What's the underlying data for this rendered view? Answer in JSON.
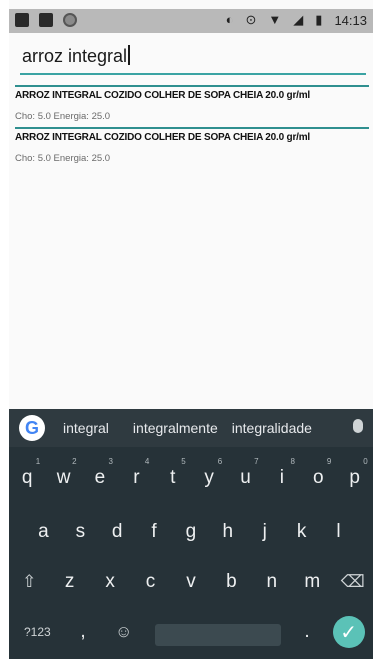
{
  "status_bar": {
    "time": "14:13"
  },
  "search": {
    "value": "arroz integral"
  },
  "results": [
    {
      "title": "ARROZ INTEGRAL COZIDO  COLHER DE SOPA CHEIA 20.0 gr/ml",
      "sub": "Cho: 5.0 Energia: 25.0"
    },
    {
      "title": "ARROZ INTEGRAL COZIDO  COLHER DE SOPA CHEIA 20.0 gr/ml",
      "sub": "Cho: 5.0 Energia: 25.0"
    }
  ],
  "keyboard": {
    "suggestions": [
      "integral",
      "integralmente",
      "integralidade"
    ],
    "row1": [
      {
        "k": "q",
        "n": "1"
      },
      {
        "k": "w",
        "n": "2"
      },
      {
        "k": "e",
        "n": "3"
      },
      {
        "k": "r",
        "n": "4"
      },
      {
        "k": "t",
        "n": "5"
      },
      {
        "k": "y",
        "n": "6"
      },
      {
        "k": "u",
        "n": "7"
      },
      {
        "k": "i",
        "n": "8"
      },
      {
        "k": "o",
        "n": "9"
      },
      {
        "k": "p",
        "n": "0"
      }
    ],
    "row2": [
      "a",
      "s",
      "d",
      "f",
      "g",
      "h",
      "j",
      "k",
      "l"
    ],
    "row3": [
      "z",
      "x",
      "c",
      "v",
      "b",
      "n",
      "m"
    ],
    "sym_label": "?123",
    "comma": ",",
    "period": "."
  },
  "icons": {
    "status": [
      "notification-icon",
      "gallery-icon",
      "sync-icon",
      "vibrate-icon",
      "alarm-icon",
      "wifi-icon",
      "signal-icon",
      "battery-icon"
    ],
    "keyboard": [
      "google-icon",
      "mic-icon",
      "shift-icon",
      "backspace-icon",
      "emoji-icon",
      "check-icon"
    ]
  },
  "colors": {
    "accent": "#3aa3a3",
    "keyboard_bg": "#263238",
    "enter": "#5bc2b7"
  }
}
